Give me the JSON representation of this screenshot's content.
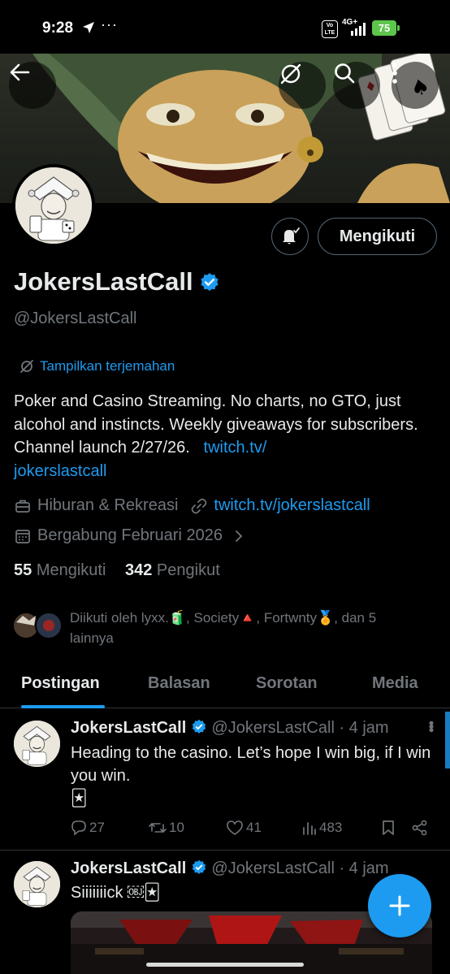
{
  "status_bar": {
    "time": "9:28",
    "send_icon": "send-icon",
    "dots": "···",
    "volte": "Vo LTE",
    "network": "4G+",
    "battery": "75"
  },
  "profile": {
    "display_name": "JokersLastCall",
    "handle": "@JokersLastCall",
    "follow_button": "Mengikuti",
    "translate_label": "Tampilkan terjemahan",
    "bio_text": "Poker and Casino Streaming. No charts, no GTO, just alcohol and instincts. Weekly giveaways for subscribers. Channel launch 2/27/26.",
    "bio_link_part1": "twitch.tv/",
    "bio_link_part2": "jokerslastcall",
    "category": "Hiburan & Rekreasi",
    "website": "twitch.tv/jokerslastcall",
    "joined": "Bergabung Februari 2026",
    "following_count": "55",
    "following_label": "Mengikuti",
    "followers_count": "342",
    "followers_label": "Pengikut",
    "followed_by": "Diikuti oleh lyxx.🧃, Society🔺, Fortwnty🏅, dan 5 lainnya"
  },
  "tabs": [
    {
      "label": "Postingan",
      "active": true
    },
    {
      "label": "Balasan",
      "active": false
    },
    {
      "label": "Sorotan",
      "active": false
    },
    {
      "label": "Media",
      "active": false
    }
  ],
  "posts": [
    {
      "name": "JokersLastCall",
      "handle": "@JokersLastCall",
      "time": "· 4 jam",
      "text": "Heading to the casino. Let’s hope I win big, if I win you win.",
      "emoji": "🃏",
      "replies": "27",
      "reposts": "10",
      "likes": "41",
      "views": "483"
    },
    {
      "name": "JokersLastCall",
      "handle": "@JokersLastCall",
      "time": "· 4 jam",
      "text": "Siiiiiiick ￼🃏"
    }
  ],
  "colors": {
    "accent": "#1d9bf0",
    "background": "#000000",
    "secondary_text": "#71767b",
    "battery": "#5dc54b"
  }
}
